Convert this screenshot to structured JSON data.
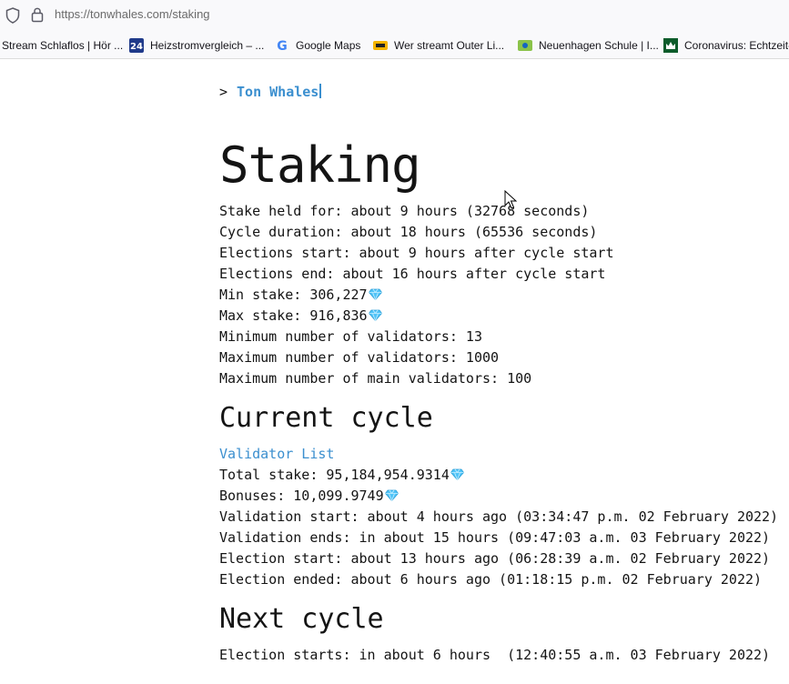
{
  "browser": {
    "url": "https://tonwhales.com/staking",
    "bookmarks": [
      {
        "label": "Stream Schlaflos | Hör ...",
        "icon": "none"
      },
      {
        "label": "Heizstromvergleich – ...",
        "icon": "heizstrom-favicon"
      },
      {
        "label": "Google Maps",
        "icon": "google-icon"
      },
      {
        "label": "Wer streamt Outer Li...",
        "icon": "justwatch-favicon"
      },
      {
        "label": "Neuenhagen Schule | I...",
        "icon": "schule-favicon"
      },
      {
        "label": "Coronavirus: Echtzeit-...",
        "icon": "crown-favicon"
      }
    ]
  },
  "header": {
    "prompt": ">",
    "brand": "Ton Whales"
  },
  "page": {
    "title": "Staking",
    "params": [
      "Stake held for: about 9 hours (32768 seconds)",
      "Cycle duration: about 18 hours (65536 seconds)",
      "Elections start: about 9 hours after cycle start",
      "Elections end: about 16 hours after cycle start",
      "Min stake: 306,227",
      "Max stake: 916,836",
      "Minimum number of validators: 13",
      "Maximum number of validators: 1000",
      "Maximum number of main validators: 100"
    ],
    "current_cycle": {
      "heading": "Current cycle",
      "validator_list_link": "Validator List",
      "total_stake": "Total stake: 95,184,954.9314",
      "bonuses": "Bonuses: 10,099.9749",
      "validation_start": "Validation start: about 4 hours ago (03:34:47 p.m. 02 February 2022)",
      "validation_ends": "Validation ends: in about 15 hours (09:47:03 a.m. 03 February 2022)",
      "election_start": "Election start: about 13 hours ago (06:28:39 a.m. 02 February 2022)",
      "election_ended": "Election ended: about 6 hours ago (01:18:15 p.m. 02 February 2022)"
    },
    "next_cycle": {
      "heading": "Next cycle",
      "election_starts": "Election starts: in about 6 hours  (12:40:55 a.m. 03 February 2022)"
    }
  },
  "colors": {
    "link": "#3b8fcf",
    "text": "#141414",
    "gem": "#4fc3f7"
  }
}
